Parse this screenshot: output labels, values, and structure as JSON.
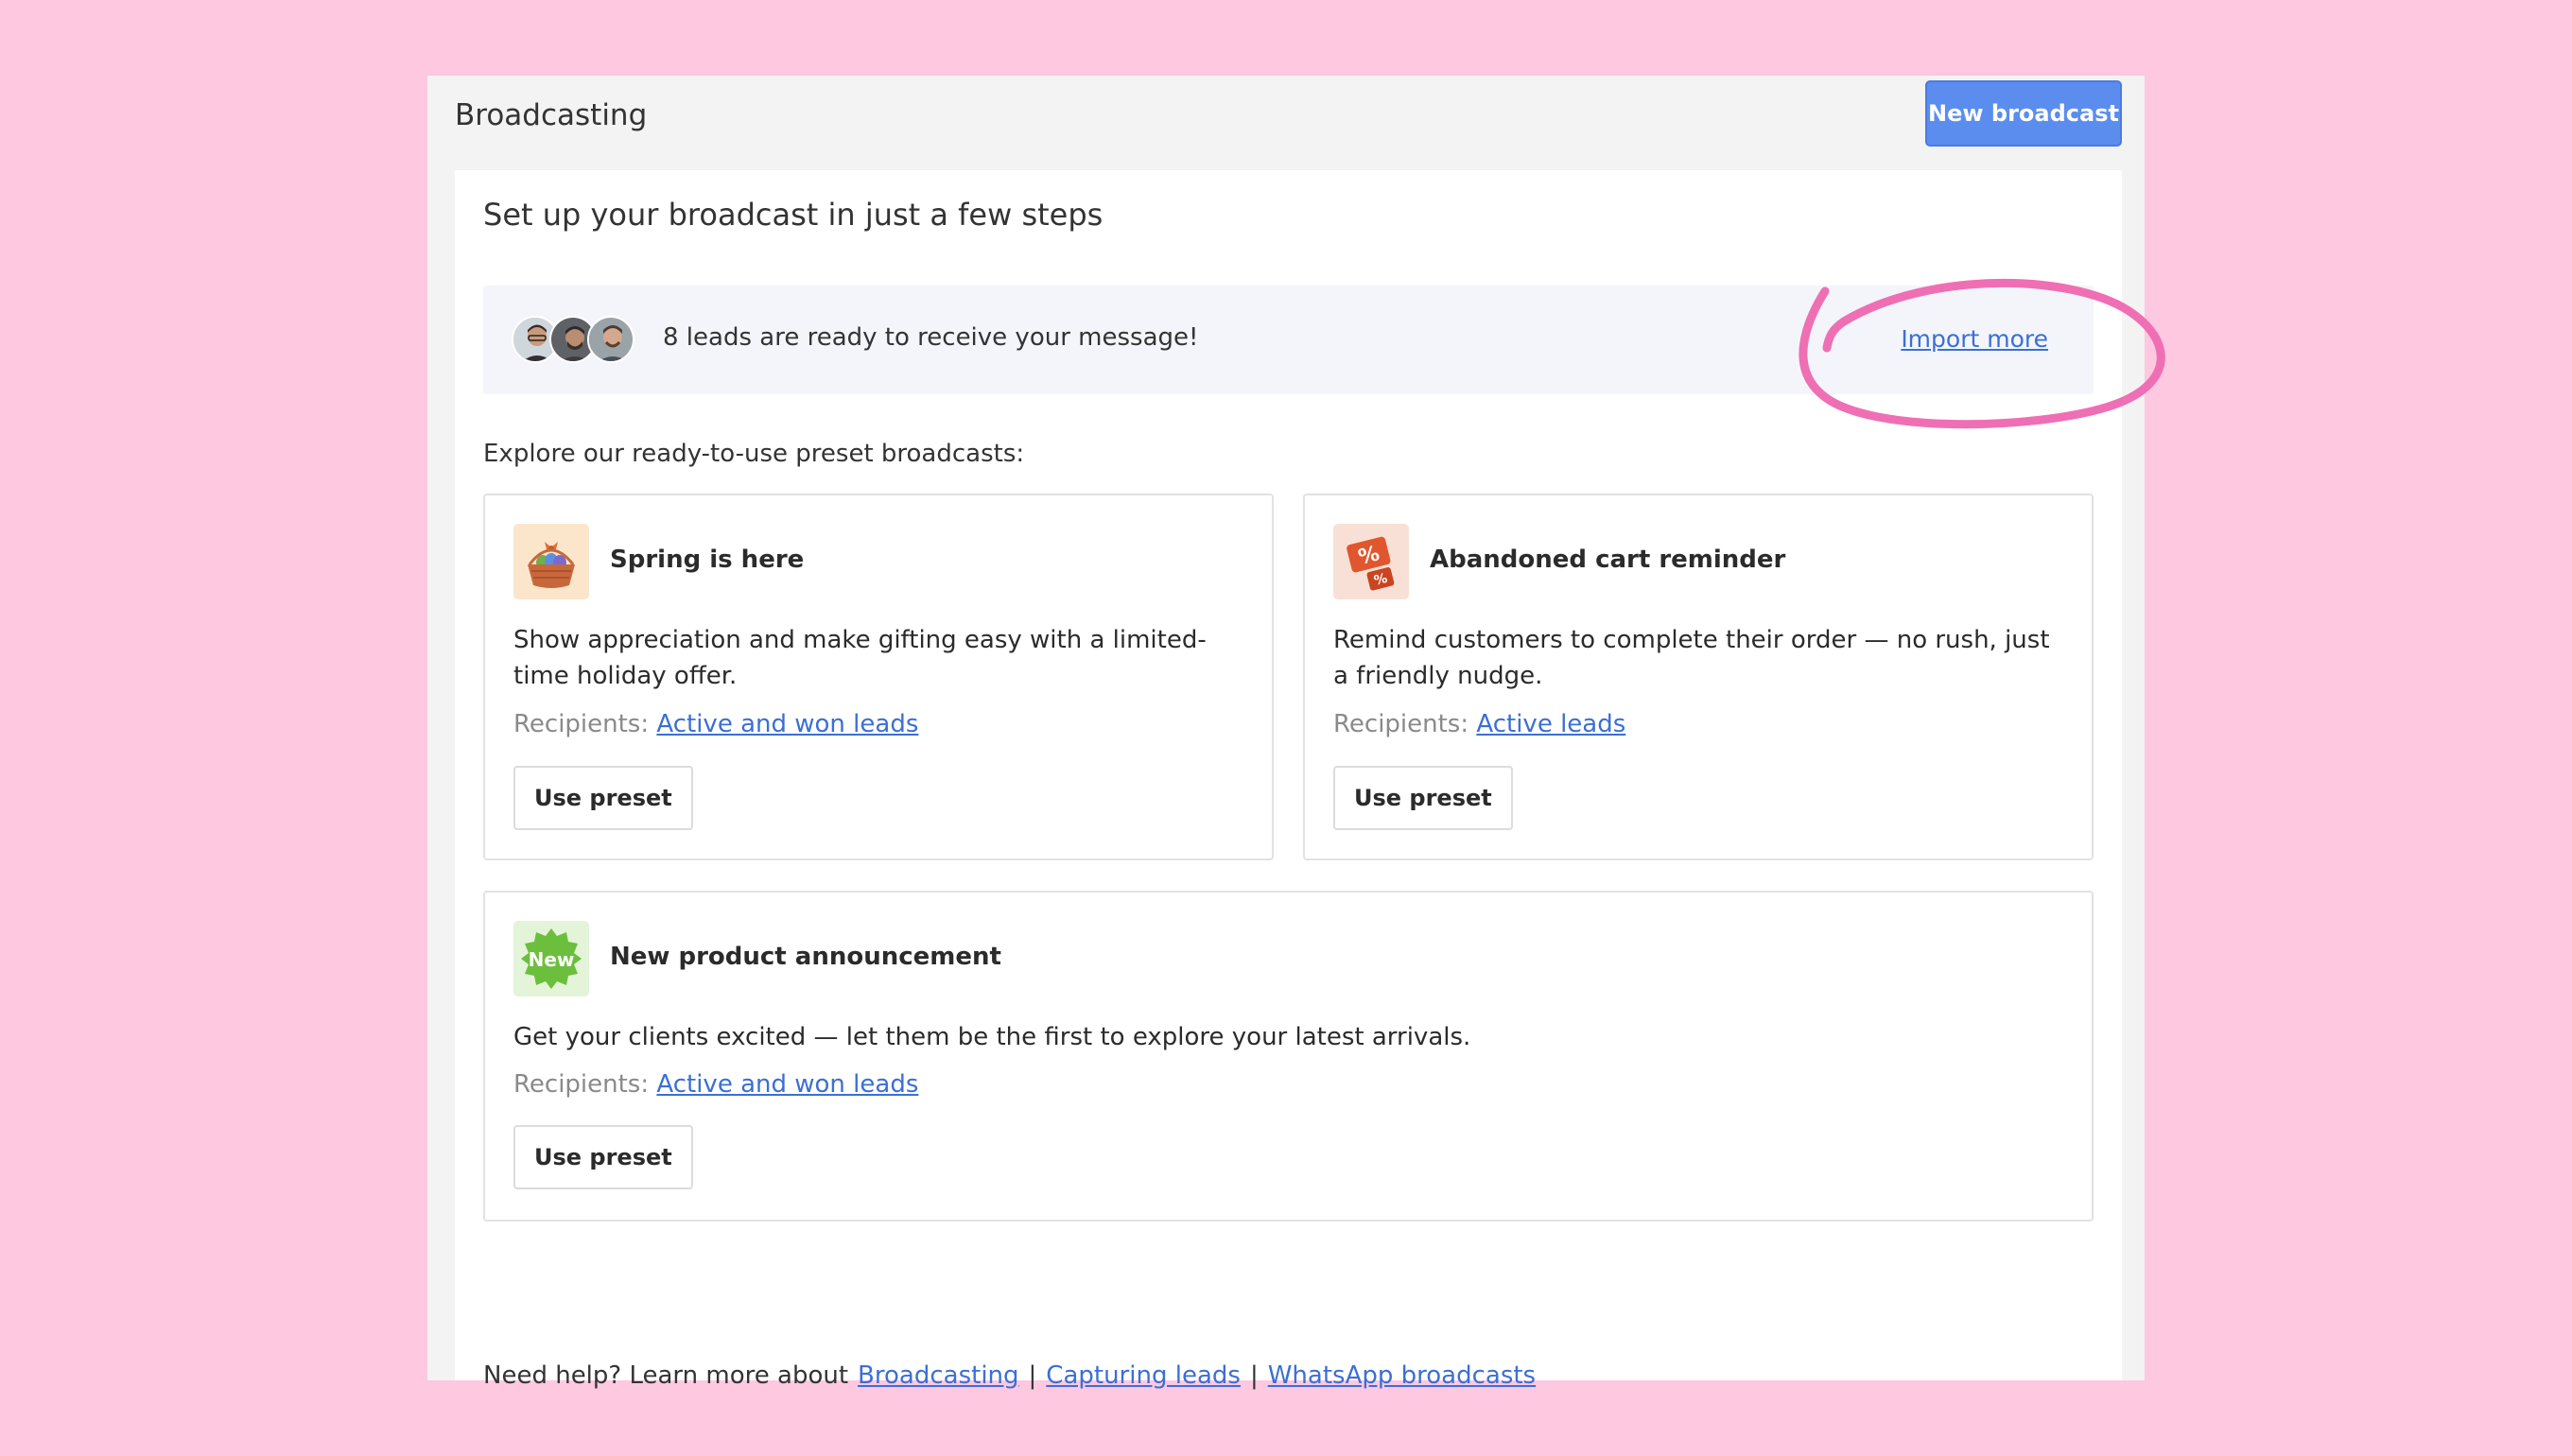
{
  "header": {
    "title": "Broadcasting",
    "new_broadcast_label": "New broadcast"
  },
  "heading": "Set up your broadcast in just a few steps",
  "leads": {
    "message": "8 leads are ready to receive your message!",
    "import_label": "Import more"
  },
  "explore_label": "Explore our ready-to-use preset broadcasts:",
  "presets": [
    {
      "title": "Spring is here",
      "description": "Show appreciation and make gifting easy with a limited-time holiday offer.",
      "recipients_label": "Recipients:",
      "recipients_link": "Active and won leads",
      "button": "Use preset",
      "icon": "gift-basket-icon"
    },
    {
      "title": "Abandoned cart reminder",
      "description": "Remind customers to complete their order — no rush, just a friendly nudge.",
      "recipients_label": "Recipients:",
      "recipients_link": "Active leads",
      "button": "Use preset",
      "icon": "discount-tag-icon",
      "icon_text": "%"
    },
    {
      "title": "New product announcement",
      "description": "Get your clients excited — let them be the first to explore your latest arrivals.",
      "recipients_label": "Recipients:",
      "recipients_link": "Active and won leads",
      "button": "Use preset",
      "icon": "new-badge-icon",
      "icon_text": "New"
    }
  ],
  "help": {
    "prefix": "Need help? Learn more about",
    "links": [
      "Broadcasting",
      "Capturing leads",
      "WhatsApp broadcasts"
    ],
    "separator": "|"
  },
  "colors": {
    "background": "#fdc8e0",
    "accent": "#5b8def",
    "link": "#3b6fd4",
    "annotation": "#ef6fb4"
  }
}
